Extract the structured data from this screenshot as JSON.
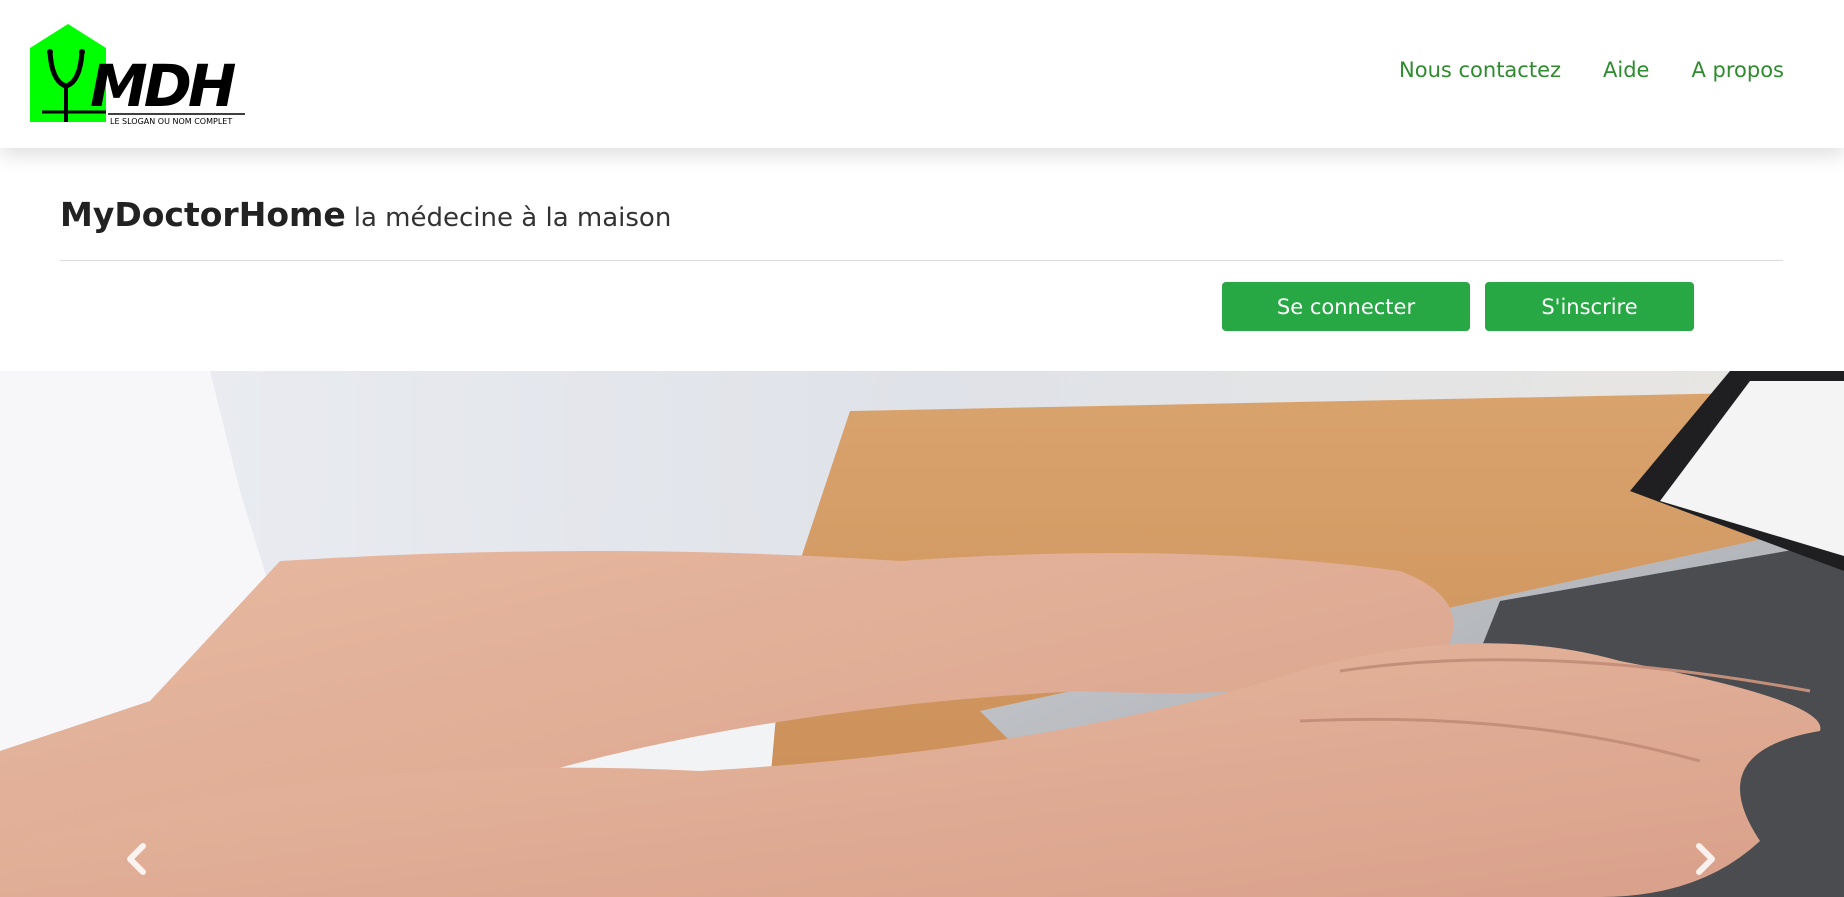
{
  "navbar": {
    "logo": {
      "text": "MDH",
      "tagline": "LE SLOGAN OU NOM COMPLET",
      "accent_color": "#00ff00"
    },
    "links": [
      {
        "label": "Nous contactez"
      },
      {
        "label": "Aide"
      },
      {
        "label": "A propos"
      }
    ],
    "link_color": "#2e8b2e"
  },
  "header": {
    "title": "MyDoctorHome",
    "subtitle": "la médecine à la maison"
  },
  "auth": {
    "login_label": "Se connecter",
    "signup_label": "S'inscrire",
    "button_color": "#28a745"
  },
  "carousel": {
    "image_icon": "hands-typing-laptop-photo",
    "prev_icon": "chevron-left-icon",
    "next_icon": "chevron-right-icon"
  }
}
